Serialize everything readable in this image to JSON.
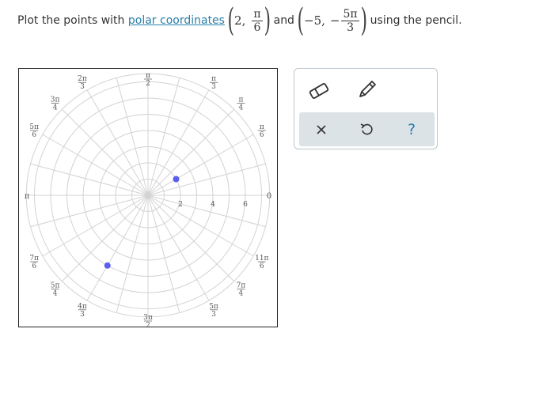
{
  "prompt": {
    "prefix": "Plot the points with ",
    "link": "polar coordinates",
    "p1_r": "2,",
    "p1_num": "π",
    "p1_den": "6",
    "and": "and",
    "p2_r": "−5,",
    "p2_sign": "−",
    "p2_num": "5π",
    "p2_den": "3",
    "suffix": "using the pencil."
  },
  "graph": {
    "angle_labels": [
      {
        "num": "",
        "den": "",
        "text": "0"
      },
      {
        "num": "π",
        "den": "6"
      },
      {
        "num": "π",
        "den": "4"
      },
      {
        "num": "π",
        "den": "3"
      },
      {
        "num": "π",
        "den": "2"
      },
      {
        "num": "2π",
        "den": "3"
      },
      {
        "num": "3π",
        "den": "4"
      },
      {
        "num": "5π",
        "den": "6"
      },
      {
        "num": "",
        "den": "",
        "text": "π"
      },
      {
        "num": "7π",
        "den": "6"
      },
      {
        "num": "5π",
        "den": "4"
      },
      {
        "num": "4π",
        "den": "3"
      },
      {
        "num": "3π",
        "den": "2"
      },
      {
        "num": "5π",
        "den": "3"
      },
      {
        "num": "7π",
        "den": "4"
      },
      {
        "num": "11π",
        "den": "6"
      }
    ],
    "radial_labels": [
      "2",
      "4",
      "6"
    ],
    "plotted_points": [
      {
        "r": 2,
        "theta": "π/6"
      },
      {
        "r": -5,
        "theta": "-5π/3"
      }
    ],
    "point_color": "#5b5ef0"
  },
  "toolbox": {
    "eraser": "eraser-icon",
    "pencil": "pencil-icon",
    "clear": "×",
    "undo": "undo-icon",
    "help": "?"
  }
}
